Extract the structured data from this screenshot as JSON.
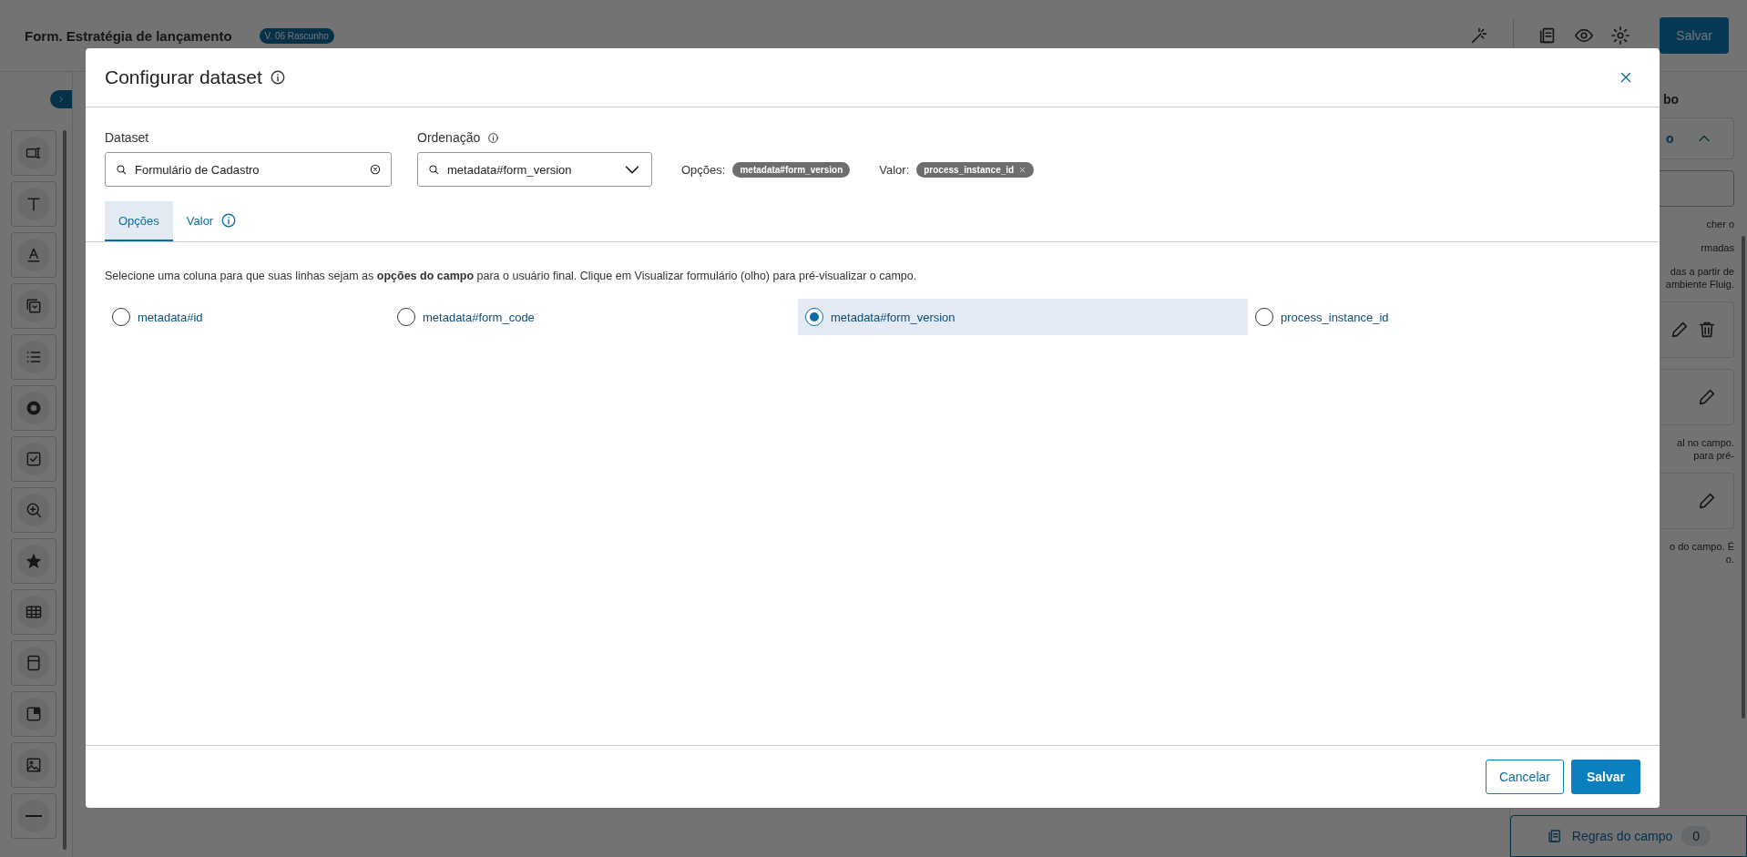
{
  "top_bar": {
    "title": "Form. Estratégia de lançamento",
    "version_badge": "V. 06 Rascunho",
    "save_button": "Salvar"
  },
  "sidebar": {
    "tools": [
      {
        "kind": "input"
      },
      {
        "kind": "text"
      },
      {
        "kind": "label"
      },
      {
        "kind": "select"
      },
      {
        "kind": "list"
      },
      {
        "kind": "radio"
      },
      {
        "kind": "checkbox"
      },
      {
        "kind": "zoom"
      },
      {
        "kind": "rating"
      },
      {
        "kind": "table"
      },
      {
        "kind": "panel"
      },
      {
        "kind": "frame"
      },
      {
        "kind": "image"
      },
      {
        "kind": "divider"
      }
    ]
  },
  "right_panel": {
    "heading": "bo",
    "section_title": "o",
    "items": [
      {
        "kind": "field"
      },
      {
        "kind": "text",
        "lines": [
          "cher o"
        ]
      },
      {
        "kind": "text",
        "lines": [
          "rmadas"
        ]
      },
      {
        "kind": "text",
        "lines": [
          "das a partir de",
          "ambiente Fluig."
        ]
      },
      {
        "kind": "card",
        "deletable": true
      },
      {
        "kind": "card",
        "deletable": false
      },
      {
        "kind": "text",
        "lines": [
          "al no campo.",
          "para pré-"
        ]
      },
      {
        "kind": "card",
        "deletable": false
      },
      {
        "kind": "text",
        "lines": [
          "o do campo. É",
          "o."
        ]
      }
    ],
    "rules_button": "Regras do campo",
    "rules_count": "0"
  },
  "modal": {
    "title": "Configurar dataset",
    "dataset": {
      "label": "Dataset",
      "value": "Formulário de Cadastro"
    },
    "ordering": {
      "label": "Ordenação",
      "value": "metadata#form_version"
    },
    "options_chip": {
      "label": "Opções:",
      "value": "metadata#form_version",
      "removable": false
    },
    "value_chip": {
      "label": "Valor:",
      "value": "process_instance_id",
      "removable": true
    },
    "tabs": [
      {
        "label": "Opções",
        "selected": true,
        "info": false
      },
      {
        "label": "Valor",
        "selected": false,
        "info": true
      }
    ],
    "description": "Selecione uma coluna para que suas linhas sejam as **opções do campo** para o usuário final. Clique em Visualizar formulário (olho) para pré-visualizar o campo.",
    "columns": [
      {
        "label": "metadata#id",
        "selected": false
      },
      {
        "label": "metadata#form_code",
        "selected": false
      },
      {
        "label": "metadata#form_version",
        "selected": true
      },
      {
        "label": "process_instance_id",
        "selected": false
      }
    ],
    "cancel_button": "Cancelar",
    "save_button": "Salvar"
  }
}
